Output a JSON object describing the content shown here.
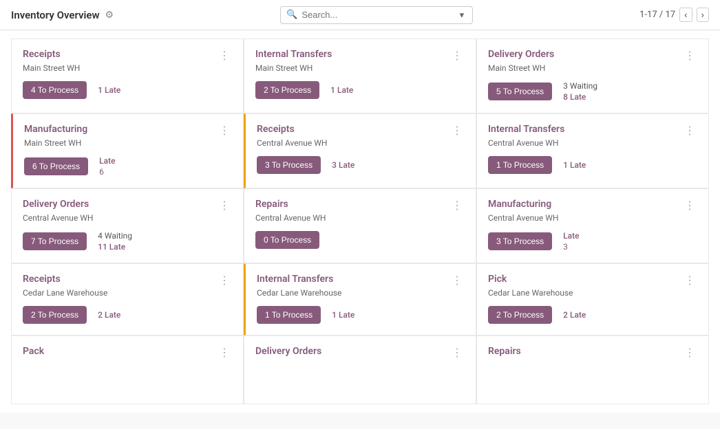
{
  "header": {
    "title": "Inventory Overview",
    "gear_label": "⚙",
    "search_placeholder": "Search...",
    "pagination": "1-17 / 17"
  },
  "cards": [
    {
      "id": "card-1",
      "title": "Receipts",
      "subtitle": "Main Street WH",
      "button_label": "4 To Process",
      "stats": [
        "1 Late"
      ],
      "stat_types": [
        "late"
      ],
      "border": "none",
      "row": 1
    },
    {
      "id": "card-2",
      "title": "Internal Transfers",
      "subtitle": "Main Street WH",
      "button_label": "2 To Process",
      "stats": [
        "1 Late"
      ],
      "stat_types": [
        "late"
      ],
      "border": "none",
      "row": 1
    },
    {
      "id": "card-3",
      "title": "Delivery Orders",
      "subtitle": "Main Street WH",
      "button_label": "5 To Process",
      "stats": [
        "3 Waiting",
        "8 Late"
      ],
      "stat_types": [
        "waiting",
        "late"
      ],
      "border": "none",
      "row": 1
    },
    {
      "id": "card-4",
      "title": "Manufacturing",
      "subtitle": "Main Street WH",
      "button_label": "6 To Process",
      "stats": [
        "Late",
        "6"
      ],
      "stat_types": [
        "late",
        "number"
      ],
      "border": "red",
      "row": 2
    },
    {
      "id": "card-5",
      "title": "Receipts",
      "subtitle": "Central Avenue WH",
      "button_label": "3 To Process",
      "stats": [
        "3 Late"
      ],
      "stat_types": [
        "late"
      ],
      "border": "yellow",
      "row": 2
    },
    {
      "id": "card-6",
      "title": "Internal Transfers",
      "subtitle": "Central Avenue WH",
      "button_label": "1 To Process",
      "stats": [
        "1 Late"
      ],
      "stat_types": [
        "late"
      ],
      "border": "none",
      "row": 2
    },
    {
      "id": "card-7",
      "title": "Delivery Orders",
      "subtitle": "Central Avenue WH",
      "button_label": "7 To Process",
      "stats": [
        "4 Waiting",
        "11 Late"
      ],
      "stat_types": [
        "waiting",
        "late"
      ],
      "border": "none",
      "row": 3
    },
    {
      "id": "card-8",
      "title": "Repairs",
      "subtitle": "Central Avenue WH",
      "button_label": "0 To Process",
      "stats": [],
      "stat_types": [],
      "border": "none",
      "row": 3
    },
    {
      "id": "card-9",
      "title": "Manufacturing",
      "subtitle": "Central Avenue WH",
      "button_label": "3 To Process",
      "stats": [
        "Late",
        "3"
      ],
      "stat_types": [
        "late",
        "number"
      ],
      "border": "none",
      "row": 3
    },
    {
      "id": "card-10",
      "title": "Receipts",
      "subtitle": "Cedar Lane Warehouse",
      "button_label": "2 To Process",
      "stats": [
        "2 Late"
      ],
      "stat_types": [
        "late"
      ],
      "border": "none",
      "row": 4
    },
    {
      "id": "card-11",
      "title": "Internal Transfers",
      "subtitle": "Cedar Lane Warehouse",
      "button_label": "1 To Process",
      "stats": [
        "1 Late"
      ],
      "stat_types": [
        "late"
      ],
      "border": "yellow",
      "row": 4
    },
    {
      "id": "card-12",
      "title": "Pick",
      "subtitle": "Cedar Lane Warehouse",
      "button_label": "2 To Process",
      "stats": [
        "2 Late"
      ],
      "stat_types": [
        "late"
      ],
      "border": "none",
      "row": 4
    },
    {
      "id": "card-13",
      "title": "Pack",
      "subtitle": "",
      "button_label": "",
      "stats": [],
      "stat_types": [],
      "border": "none",
      "row": 5
    },
    {
      "id": "card-14",
      "title": "Delivery Orders",
      "subtitle": "",
      "button_label": "",
      "stats": [],
      "stat_types": [],
      "border": "none",
      "row": 5
    },
    {
      "id": "card-15",
      "title": "Repairs",
      "subtitle": "",
      "button_label": "",
      "stats": [],
      "stat_types": [],
      "border": "none",
      "row": 5
    }
  ],
  "menu_icon": "⋮",
  "prev_label": "‹",
  "next_label": "›"
}
